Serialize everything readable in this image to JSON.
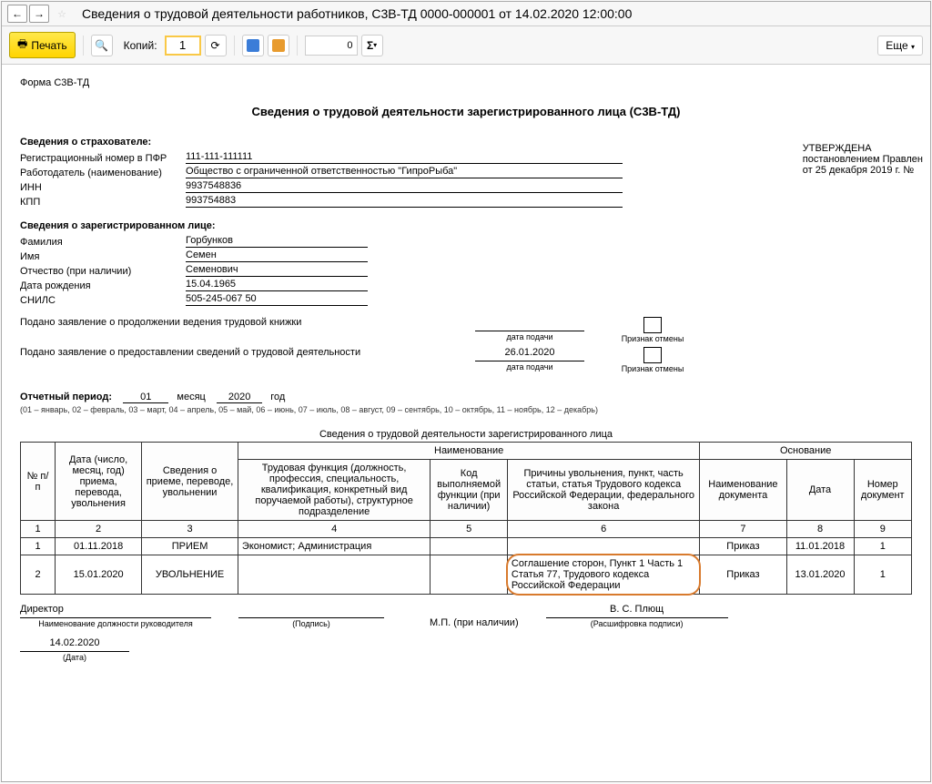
{
  "titlebar": {
    "title": "Сведения о трудовой деятельности работников, С3В-ТД 0000-000001 от 14.02.2020 12:00:00"
  },
  "toolbar": {
    "print_label": "Печать",
    "copies_label": "Копий:",
    "copies_value": "1",
    "zero_value": "0",
    "more_label": "Еще"
  },
  "approved": {
    "l1": "УТВЕРЖДЕНА",
    "l2": "постановлением Правлен",
    "l3": "от 25 декабря 2019 г. №"
  },
  "form_label": "Форма С3В-ТД",
  "heading": "Сведения о трудовой деятельности зарегистрированного лица (С3В-ТД)",
  "insurer_h": "Сведения о страхователе:",
  "insurer": {
    "reg_label": "Регистрационный номер в ПФР",
    "reg_val": "111-111-111111",
    "emp_label": "Работодатель (наименование)",
    "emp_val": "Общество с ограниченной ответственностью \"ГипроРыба\"",
    "inn_label": "ИНН",
    "inn_val": "9937548836",
    "kpp_label": "КПП",
    "kpp_val": "993754883"
  },
  "person_h": "Сведения о зарегистрированном лице:",
  "person": {
    "ln_label": "Фамилия",
    "ln_val": "Горбунков",
    "fn_label": "Имя",
    "fn_val": "Семен",
    "mn_label": "Отчество (при наличии)",
    "mn_val": "Семенович",
    "dob_label": "Дата рождения",
    "dob_val": "15.04.1965",
    "snils_label": "СНИЛС",
    "snils_val": "505-245-067 50"
  },
  "stmt1": "Подано заявление о продолжении ведения трудовой книжки",
  "stmt2": "Подано заявление о предоставлении сведений о трудовой деятельности",
  "date_caption": "дата подачи",
  "cancel_caption": "Признак отмены",
  "stmt2_date": "26.01.2020",
  "period": {
    "label": "Отчетный период:",
    "month": "01",
    "month_label": "месяц",
    "year": "2020",
    "year_label": "год",
    "hint": "(01 – январь, 02 – февраль, 03 – март, 04 – апрель, 05 – май, 06 – июнь, 07 – июль, 08 – август, 09 – сентябрь, 10 – октябрь, 11 – ноябрь, 12 – декабрь)"
  },
  "tbl": {
    "title": "Сведения о трудовой деятельности зарегистрированного лица",
    "h_idx": "№ п/п",
    "h_date": "Дата (число, месяц, год) приема, перевода, увольнения",
    "h_kind": "Сведения о приеме, переводе, увольнении",
    "h_name": "Наименование",
    "h_func": "Трудовая функция (должность, профессия, специальность, квалификация, конкретный вид поручаемой работы), структурное подразделение",
    "h_code": "Код выполняемой функции (при наличии)",
    "h_reason": "Причины увольнения, пункт, часть статьи, статья Трудового кодекса Российской Федерации, федерального закона",
    "h_basis": "Основание",
    "h_docname": "Наименование документа",
    "h_docdate": "Дата",
    "h_docnum": "Номер документ",
    "cols": [
      "1",
      "2",
      "3",
      "4",
      "5",
      "6",
      "7",
      "8",
      "9"
    ],
    "rows": [
      {
        "n": "1",
        "date": "01.11.2018",
        "kind": "ПРИЕМ",
        "func": "Экономист; Администрация",
        "code": "",
        "reason": "",
        "docn": "Приказ",
        "docd": "11.01.2018",
        "docnum": "1"
      },
      {
        "n": "2",
        "date": "15.01.2020",
        "kind": "УВОЛЬНЕНИЕ",
        "func": "",
        "code": "",
        "reason": "Соглашение сторон,   Пункт 1 Часть 1 Статья 77, Трудового кодекса Российской Федерации",
        "docn": "Приказ",
        "docd": "13.01.2020",
        "docnum": "1"
      }
    ]
  },
  "sig": {
    "director": "Директор",
    "director_cap": "Наименование должности руководителя",
    "sign_cap": "(Подпись)",
    "name_val": "В. С. Плющ",
    "name_cap": "(Расшифровка подписи)",
    "mp": "М.П. (при наличии)",
    "doc_date": "14.02.2020",
    "date_cap": "(Дата)"
  }
}
